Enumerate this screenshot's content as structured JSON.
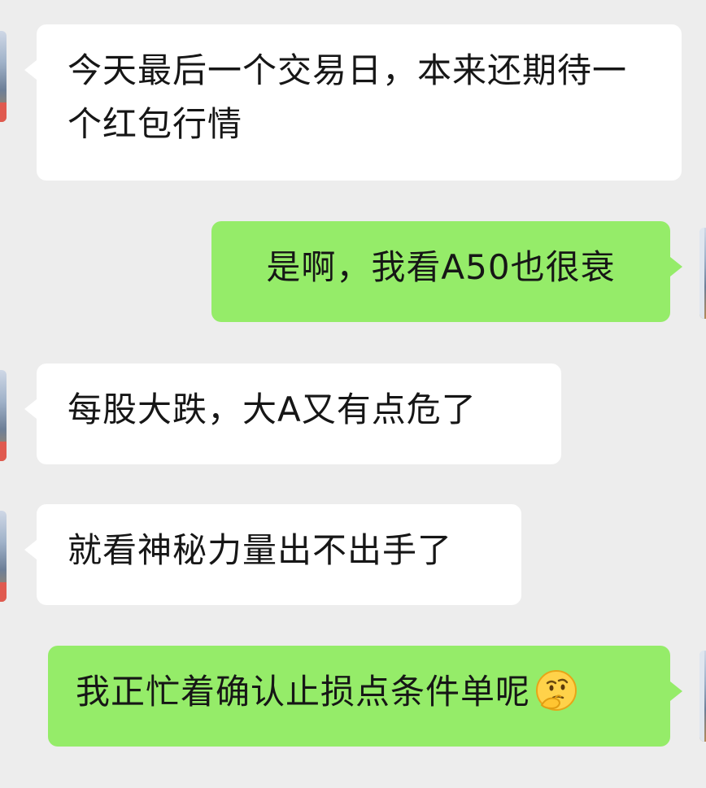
{
  "messages": [
    {
      "side": "left",
      "text": "今天最后一个交易日，本来还期待一个红包行情"
    },
    {
      "side": "right",
      "text": "是啊，我看A50也很衰"
    },
    {
      "side": "left",
      "text": "每股大跌，大A又有点危了"
    },
    {
      "side": "left",
      "text": "就看神秘力量出不出手了"
    },
    {
      "side": "right",
      "text": "我正忙着确认止损点条件单呢",
      "emoji": "thinking-face"
    }
  ],
  "colors": {
    "background": "#ededed",
    "incoming_bubble": "#ffffff",
    "outgoing_bubble": "#95ec69",
    "text": "#161616"
  }
}
